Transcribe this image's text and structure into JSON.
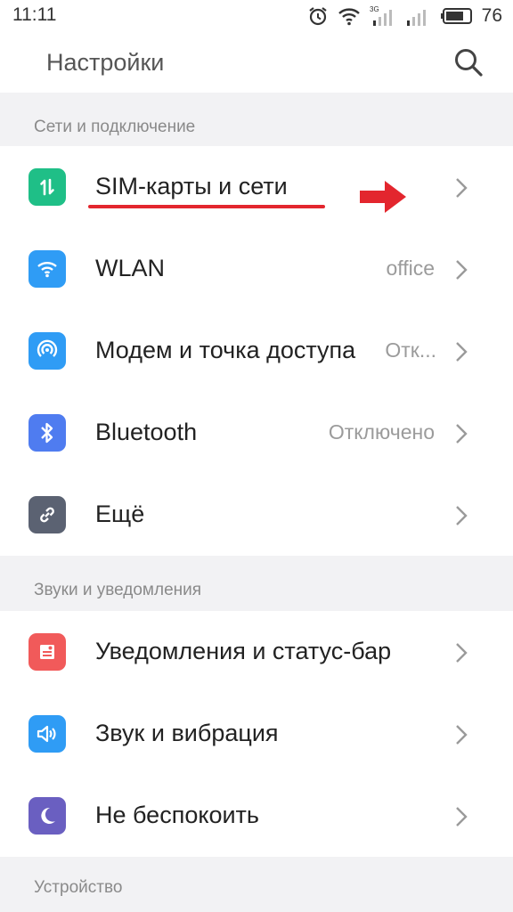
{
  "status_bar": {
    "time": "11:11",
    "network_label": "3G",
    "battery": "76"
  },
  "header": {
    "title": "Настройки",
    "search_icon": "search-icon"
  },
  "sections": [
    {
      "title": "Сети и подключение",
      "items": [
        {
          "label": "SIM-карты и сети",
          "value": "",
          "icon": "sim-transfer-icon",
          "color": "#1fbf87"
        },
        {
          "label": "WLAN",
          "value": "office",
          "icon": "wifi-icon",
          "color": "#2f9cf5"
        },
        {
          "label": "Модем и точка доступа",
          "value": "Отк...",
          "icon": "hotspot-icon",
          "color": "#2f9cf5"
        },
        {
          "label": "Bluetooth",
          "value": "Отключено",
          "icon": "bluetooth-icon",
          "color": "#4f7cf0"
        },
        {
          "label": "Ещё",
          "value": "",
          "icon": "link-icon",
          "color": "#5b6272"
        }
      ]
    },
    {
      "title": "Звуки и уведомления",
      "items": [
        {
          "label": "Уведомления и статус-бар",
          "value": "",
          "icon": "notification-icon",
          "color": "#f15a5a"
        },
        {
          "label": "Звук и вибрация",
          "value": "",
          "icon": "speaker-icon",
          "color": "#2f9cf5"
        },
        {
          "label": "Не беспокоить",
          "value": "",
          "icon": "moon-icon",
          "color": "#6a5fc1"
        }
      ]
    },
    {
      "title": "Устройство",
      "items": []
    }
  ],
  "annotation": {
    "color": "#e3262e"
  }
}
